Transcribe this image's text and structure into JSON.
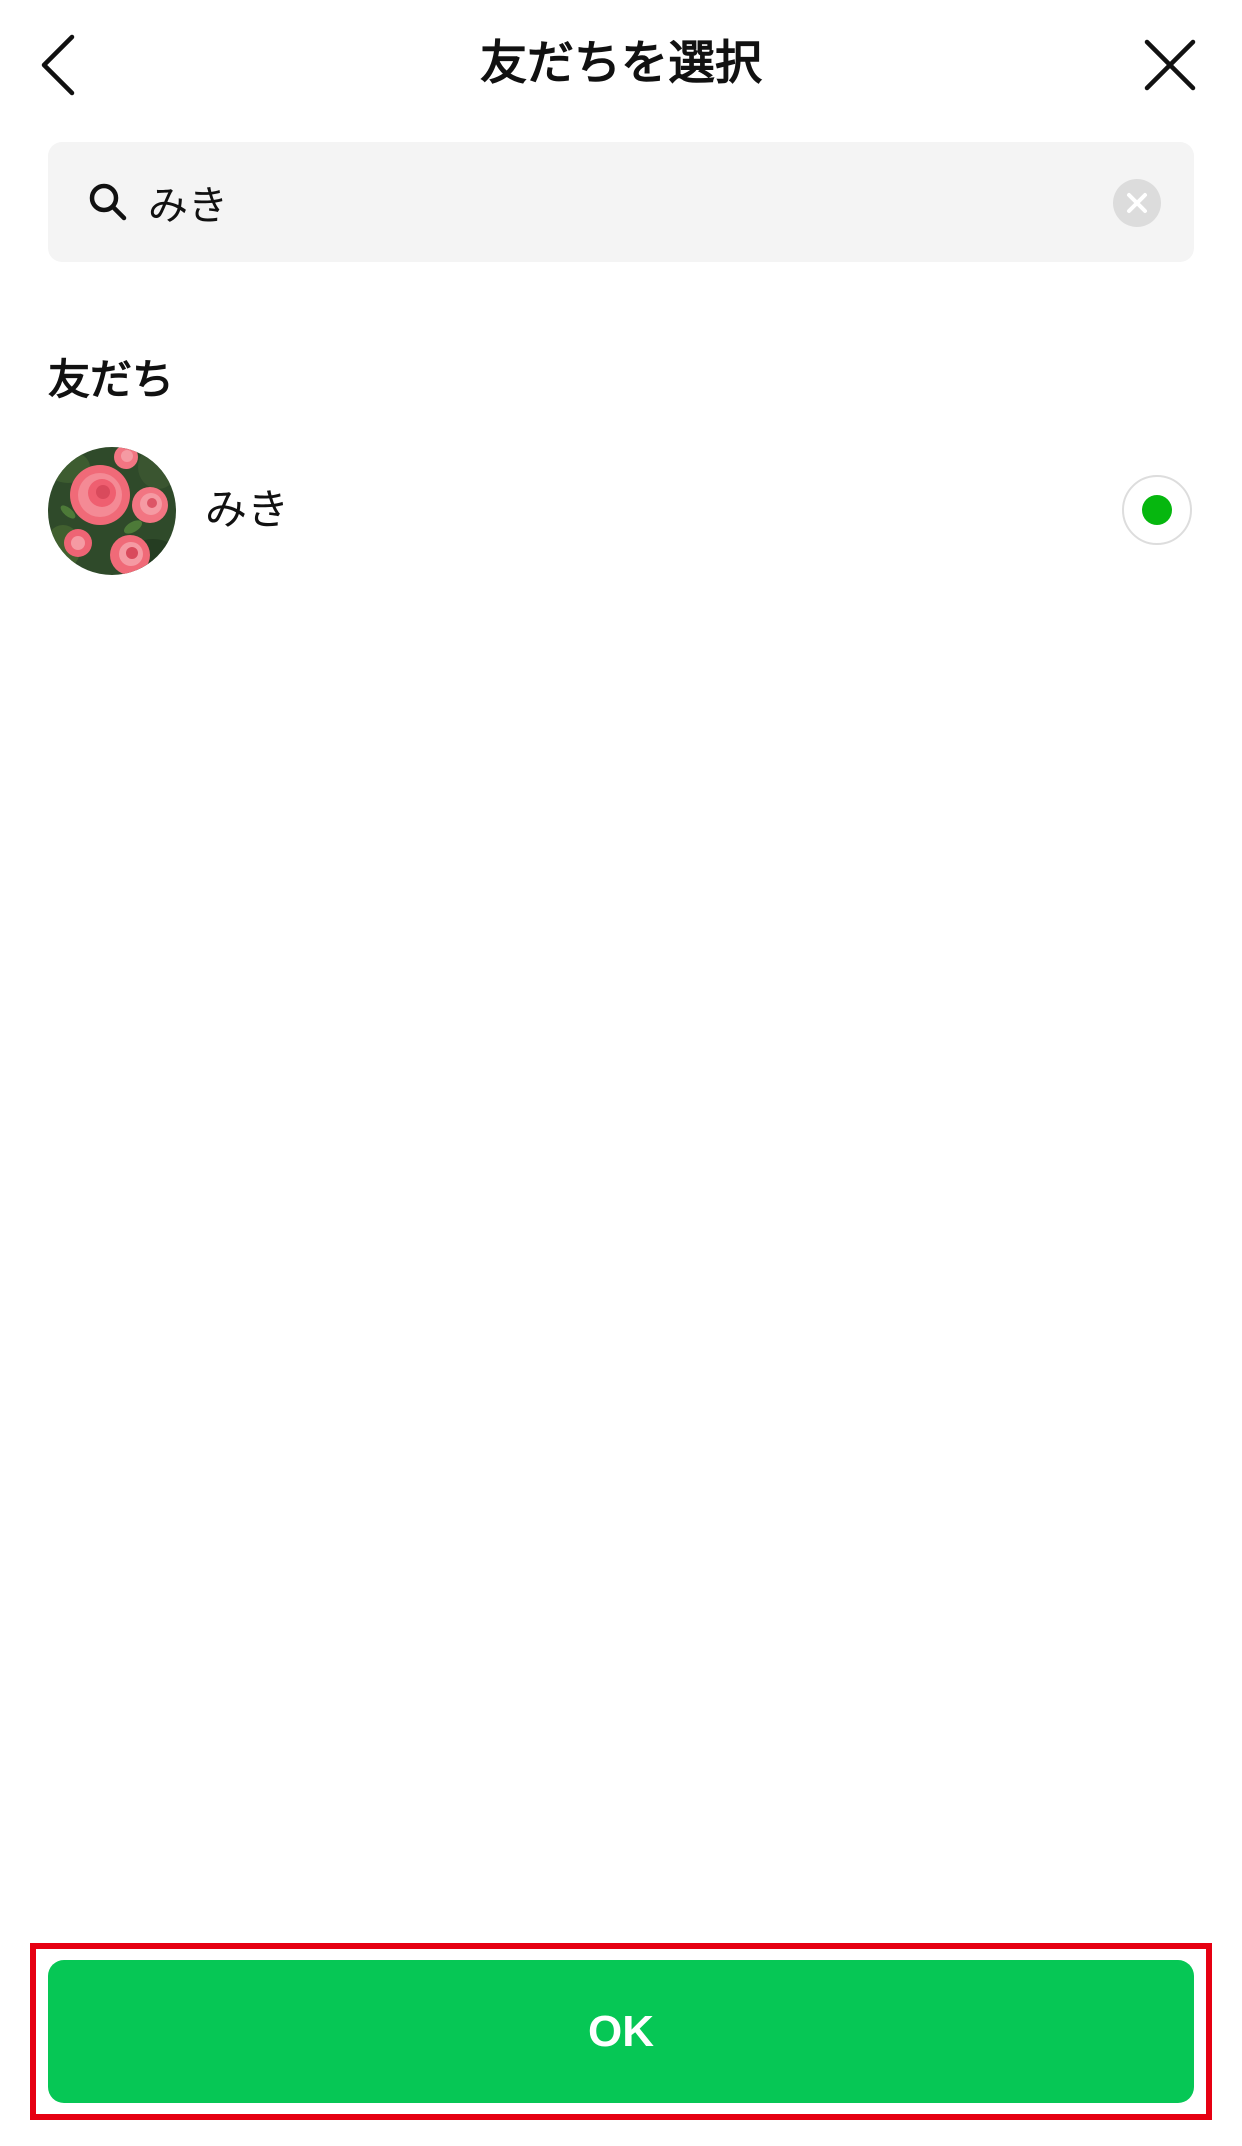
{
  "header": {
    "title": "友だちを選択",
    "back_icon": "chevron-left-icon",
    "close_icon": "close-icon"
  },
  "search": {
    "value": "みき",
    "icon": "search-icon",
    "clear_icon": "clear-icon"
  },
  "friends_section": {
    "header": "友だち",
    "items": [
      {
        "name": "みき",
        "avatar": "rose-avatar",
        "selected": true
      }
    ]
  },
  "footer": {
    "ok_label": "OK"
  },
  "colors": {
    "accent_green": "#06c755",
    "radio_dot": "#06b70f",
    "highlight_red": "#e60012",
    "search_bg": "#f4f4f4"
  }
}
